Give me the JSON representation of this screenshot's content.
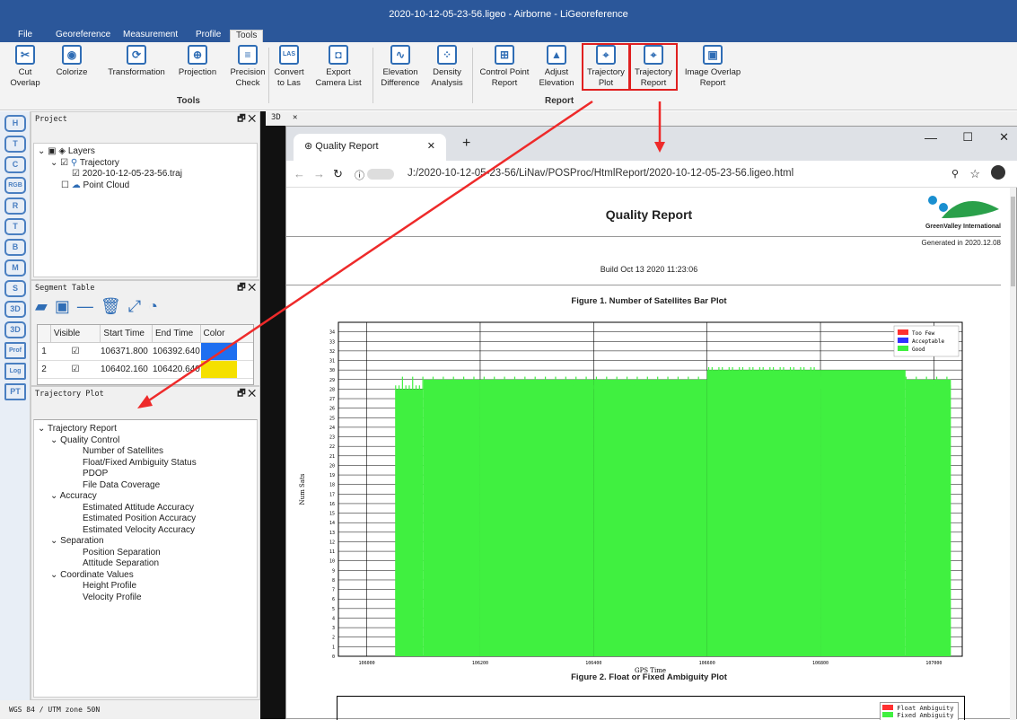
{
  "title": "2020-10-12-05-23-56.ligeo - Airborne - LiGeoreference",
  "menu": [
    "File",
    "Georeference",
    "Measurement",
    "Profile",
    "Tools"
  ],
  "ribbon": {
    "buttons": [
      {
        "label1": "Cut",
        "label2": "Overlap",
        "icon": "cut-overlap-icon",
        "glyph": "✂"
      },
      {
        "label1": "Colorize",
        "label2": "",
        "icon": "colorize-icon",
        "glyph": "◉"
      },
      {
        "label1": "Transformation",
        "label2": "",
        "icon": "transformation-icon",
        "glyph": "⟳"
      },
      {
        "label1": "Projection",
        "label2": "",
        "icon": "projection-icon",
        "glyph": "⊕"
      },
      {
        "label1": "Precision",
        "label2": "Check",
        "icon": "precision-check-icon",
        "glyph": "≡"
      },
      {
        "label1": "Convert",
        "label2": "to Las",
        "icon": "las-icon",
        "glyph": "LAS"
      },
      {
        "label1": "Export",
        "label2": "Camera List",
        "icon": "camera-icon",
        "glyph": "◘"
      },
      {
        "label1": "Elevation",
        "label2": "Difference",
        "icon": "elevation-difference-icon",
        "glyph": "∿"
      },
      {
        "label1": "Density",
        "label2": "Analysis",
        "icon": "density-icon",
        "glyph": "⁘"
      },
      {
        "label1": "Control Point",
        "label2": "Report",
        "icon": "control-point-icon",
        "glyph": "⊞"
      },
      {
        "label1": "Adjust",
        "label2": "Elevation",
        "icon": "adjust-elevation-icon",
        "glyph": "▲"
      },
      {
        "label1": "Trajectory",
        "label2": "Plot",
        "icon": "trajectory-plot-icon",
        "glyph": "⌖"
      },
      {
        "label1": "Trajectory",
        "label2": "Report",
        "icon": "trajectory-report-icon",
        "glyph": "⌖"
      },
      {
        "label1": "Image Overlap",
        "label2": "Report",
        "icon": "image-overlap-icon",
        "glyph": "▣"
      }
    ],
    "group_tools": "Tools",
    "group_report": "Report"
  },
  "left_tools": [
    "H",
    "T",
    "C",
    "RGB",
    "R",
    "T",
    "B",
    "M",
    "S",
    "3D",
    "3D",
    "Prof",
    "Log",
    "PT"
  ],
  "project": {
    "title": "Project",
    "layers": "Layers",
    "trajectory": "Trajectory",
    "traj_file": "2020-10-12-05-23-56.traj",
    "point_cloud": "Point Cloud"
  },
  "segment": {
    "title": "Segment Table",
    "headers": [
      "Visible",
      "Start Time",
      "End Time",
      "Color"
    ],
    "rows": [
      {
        "n": "1",
        "start": "106371.800",
        "end": "106392.640",
        "color": "#1e6ff0"
      },
      {
        "n": "2",
        "start": "106402.160",
        "end": "106420.640",
        "color": "#f5e000"
      }
    ]
  },
  "trajplot": {
    "title": "Trajectory Plot",
    "items": [
      {
        "t": "Trajectory Report",
        "lvl": 0,
        "exp": true
      },
      {
        "t": "Quality Control",
        "lvl": 1,
        "exp": true
      },
      {
        "t": "Number of Satellites",
        "lvl": 2
      },
      {
        "t": "Float/Fixed Ambiguity Status",
        "lvl": 2
      },
      {
        "t": "PDOP",
        "lvl": 2
      },
      {
        "t": "File Data Coverage",
        "lvl": 2
      },
      {
        "t": "Accuracy",
        "lvl": 1,
        "exp": true
      },
      {
        "t": "Estimated Attitude Accuracy",
        "lvl": 2
      },
      {
        "t": "Estimated Position Accuracy",
        "lvl": 2
      },
      {
        "t": "Estimated Velocity Accuracy",
        "lvl": 2
      },
      {
        "t": "Separation",
        "lvl": 1,
        "exp": true
      },
      {
        "t": "Position Separation",
        "lvl": 2
      },
      {
        "t": "Attitude Separation",
        "lvl": 2
      },
      {
        "t": "Coordinate Values",
        "lvl": 1,
        "exp": true
      },
      {
        "t": "Height Profile",
        "lvl": 2
      },
      {
        "t": "Velocity Profile",
        "lvl": 2
      }
    ]
  },
  "status": "WGS 84 / UTM zone 50N",
  "view_tab": "3D",
  "browser": {
    "tab": "Quality Report",
    "url": "J:/2020-10-12-05-23-56/LiNav/POSProc/HtmlReport/2020-10-12-05-23-56.ligeo.html",
    "report_title": "Quality Report",
    "logo_text": "GreenValley International",
    "generated": "Generated in 2020.12.08",
    "build": "Build Oct 13 2020 11:23:06",
    "fig1_title": "Figure 1. Number of Satellites Bar Plot",
    "fig2_title": "Figure 2. Float or Fixed Ambiguity Plot",
    "fig2_legend": [
      "Float Ambiguity",
      "Fixed Ambiguity"
    ]
  },
  "chart_data": {
    "type": "bar",
    "title": "Figure 1. Number of Satellites Bar Plot",
    "xlabel": "GPS Time",
    "ylabel": "Num Sats",
    "xlim": [
      105950,
      107050
    ],
    "ylim": [
      0,
      35
    ],
    "xticks": [
      106000,
      106200,
      106400,
      106600,
      106800,
      107000
    ],
    "yticks": [
      0,
      1,
      2,
      3,
      4,
      5,
      6,
      7,
      8,
      9,
      10,
      11,
      12,
      13,
      14,
      15,
      16,
      17,
      18,
      19,
      20,
      21,
      22,
      23,
      24,
      25,
      26,
      27,
      28,
      29,
      30,
      31,
      32,
      33,
      34
    ],
    "legend": [
      "Too Few",
      "Acceptable",
      "Good"
    ],
    "legend_colors": [
      "#ff3030",
      "#3030ff",
      "#40f040"
    ],
    "series": [
      {
        "x": [
          106050,
          106100,
          106100,
          106200,
          106200,
          106400,
          106400,
          106600,
          106600,
          106800,
          106800,
          106950,
          106950,
          107030
        ],
        "y": [
          28,
          28,
          29,
          29,
          29,
          29,
          29,
          29,
          30,
          30,
          30,
          30,
          29,
          29
        ]
      }
    ],
    "x_start": 106050,
    "x_end": 107030
  }
}
